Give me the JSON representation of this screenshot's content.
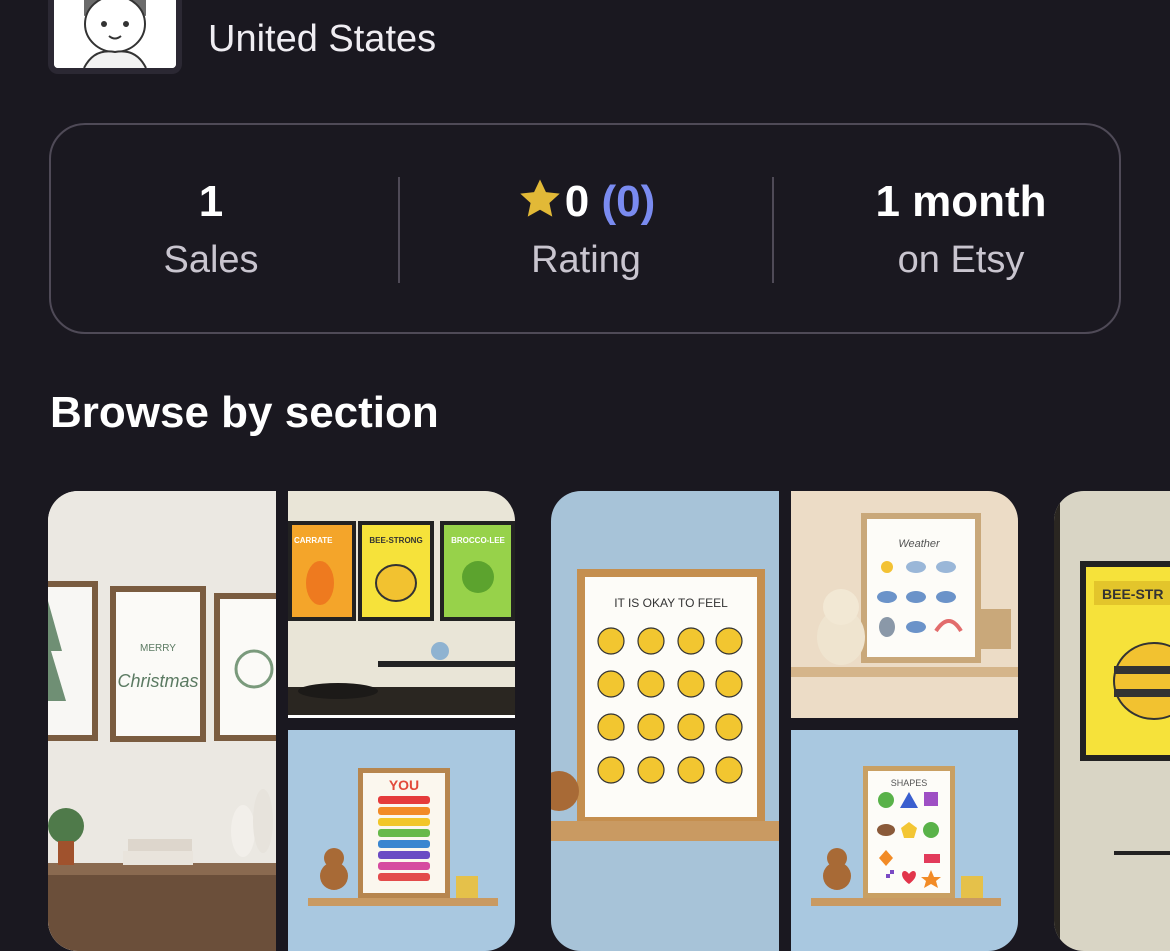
{
  "shop": {
    "location": "United States"
  },
  "stats": [
    {
      "value": "1",
      "label": "Sales"
    },
    {
      "value": "0",
      "count": "(0)",
      "label": "Rating"
    },
    {
      "value": "1 month",
      "label": "on Etsy"
    }
  ],
  "browse": {
    "heading": "Browse by section"
  },
  "artwork_text": {
    "merry": "MERRY",
    "christmas": "Christmas",
    "carrate": "CARRATE",
    "bee_strong": "BEE-STRONG",
    "brocco_lee": "BROCCO-LEE",
    "feel_title": "IT IS OKAY TO FEEL",
    "weather_title": "Weather",
    "you": "YOU",
    "shapes_title": "SHAPES",
    "bee_str": "BEE-STR"
  },
  "colors": {
    "background": "#1a1820",
    "border": "#4f4a57",
    "accent_link": "#7a8bf0",
    "star": "#e2b937"
  },
  "icons": {
    "star": "star-icon"
  }
}
